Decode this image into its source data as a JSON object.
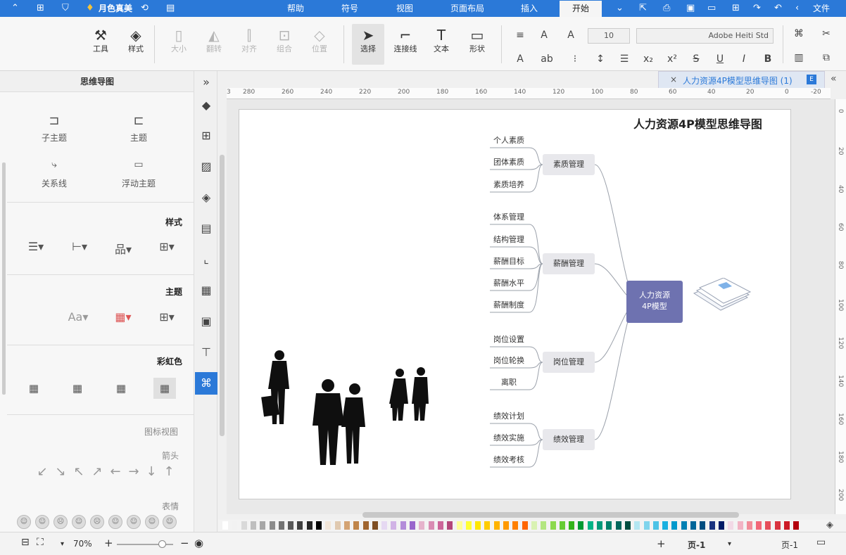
{
  "menubar": {
    "file": "文件",
    "tabs": [
      "开始",
      "插入",
      "页面布局",
      "视图",
      "符号",
      "帮助"
    ],
    "user": "月色真美"
  },
  "ribbon": {
    "font_name": "Adobe Heiti Std",
    "font_size": "10",
    "tools": {
      "shape": "形状",
      "text": "文本",
      "connector": "连接线",
      "select": "选择",
      "position": "位置",
      "group": "组合",
      "align": "对齐",
      "flip": "翻转",
      "size": "大小",
      "style": "样式",
      "tools": "工具"
    }
  },
  "doc_tab": {
    "title": "人力资源4P模型思维导图 (1)"
  },
  "left_panel": {
    "title": "思维导图",
    "topic": "主题",
    "subtopic": "子主题",
    "float_topic": "浮动主题",
    "relation": "关系线",
    "style_header": "样式",
    "theme_header": "主题",
    "rainbow_header": "彩虹色",
    "icon_view": "图标视图",
    "arrow": "箭头",
    "emotion": "表情"
  },
  "mindmap": {
    "title": "人力资源4P模型思维导图",
    "central": [
      "人力资源",
      "4P模型"
    ],
    "branches": [
      {
        "name": "素质管理",
        "leaves": [
          "个人素质",
          "团体素质",
          "素质培养"
        ]
      },
      {
        "name": "薪酬管理",
        "leaves": [
          "体系管理",
          "结构管理",
          "薪酬目标",
          "薪酬水平",
          "薪酬制度"
        ]
      },
      {
        "name": "岗位管理",
        "leaves": [
          "岗位设置",
          "岗位轮换",
          "离职"
        ]
      },
      {
        "name": "绩效管理",
        "leaves": [
          "绩效计划",
          "绩效实施",
          "绩效考核"
        ]
      }
    ]
  },
  "ruler_top": [
    "-20",
    "0",
    "20",
    "40",
    "60",
    "80",
    "100",
    "120",
    "140",
    "160",
    "180",
    "200",
    "220",
    "240",
    "260",
    "280",
    "3"
  ],
  "ruler_left": [
    "0",
    "20",
    "40",
    "60",
    "80",
    "100",
    "120",
    "140",
    "160",
    "180",
    "200"
  ],
  "statusbar": {
    "page_label": "页-1",
    "page_tab": "页-1",
    "zoom": "70%"
  },
  "colors": {
    "accent": "#2b79d8",
    "central": "#6e72b0",
    "branch": "#e8e8ec"
  }
}
